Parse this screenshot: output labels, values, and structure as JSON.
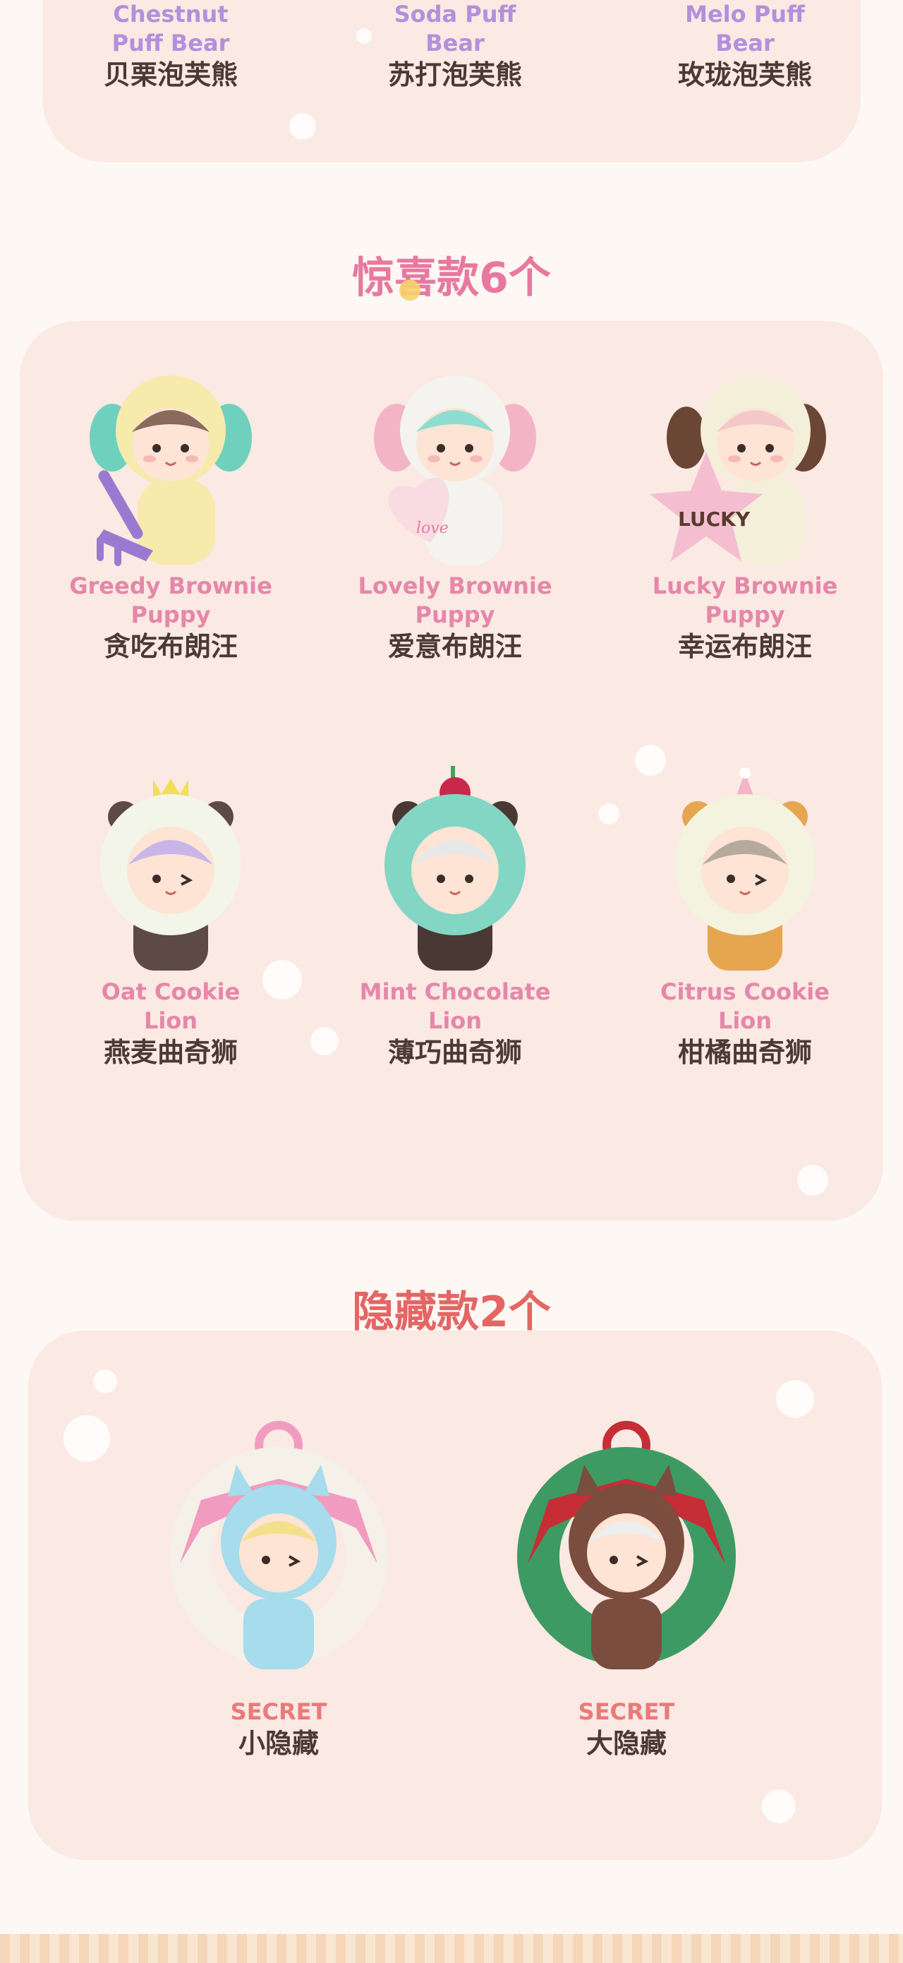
{
  "top_series": {
    "items": [
      {
        "en": "Chestnut Puff Bear",
        "cn": "贝栗泡芙熊"
      },
      {
        "en": "Soda Puff Bear",
        "cn": "苏打泡芙熊"
      },
      {
        "en": "Melo Puff Bear",
        "cn": "玫珑泡芙熊"
      }
    ]
  },
  "surprise": {
    "title": "惊喜款6个",
    "items": [
      {
        "en": "Greedy Brownie Puppy",
        "cn": "贪吃布朗汪",
        "icon": "puppy-figure-icon",
        "hood": "#f6ebab",
        "ear": "#6fd1bd",
        "prop": "rake"
      },
      {
        "en": "Lovely Brownie Puppy",
        "cn": "爱意布朗汪",
        "icon": "puppy-figure-icon",
        "hood": "#f4f3f0",
        "ear": "#f3b4c8",
        "prop": "heart",
        "prop_text": "love"
      },
      {
        "en": "Lucky Brownie Puppy",
        "cn": "幸运布朗汪",
        "icon": "puppy-figure-icon",
        "hood": "#f4efd9",
        "ear": "#6b4634",
        "prop": "star",
        "prop_text": "LUCKY"
      },
      {
        "en": "Oat Cookie Lion",
        "cn": "燕麦曲奇狮",
        "icon": "lion-figure-icon",
        "mane": "#f2f5e7",
        "hair": "#c9b6e8",
        "body": "#5e4a44",
        "topper": "crown"
      },
      {
        "en": "Mint Chocolate Lion",
        "cn": "薄巧曲奇狮",
        "icon": "lion-figure-icon",
        "mane": "#83d5c4",
        "hair": "#e8e8e8",
        "body": "#4a3835",
        "topper": "cherry"
      },
      {
        "en": "Citrus Cookie Lion",
        "cn": "柑橘曲奇狮",
        "icon": "lion-figure-icon",
        "mane": "#f4f3df",
        "hair": "#b6aa9c",
        "body": "#e6a54f",
        "topper": "party-hat"
      }
    ]
  },
  "secret": {
    "title": "隐藏款2个",
    "items": [
      {
        "en": "SECRET",
        "cn": "小隐藏",
        "icon": "wreath-figure-icon",
        "wreath": "#f5f0e8",
        "bow": "#f29bc1",
        "suit": "#a6dcec"
      },
      {
        "en": "SECRET",
        "cn": "大隐藏",
        "icon": "wreath-figure-icon",
        "wreath": "#3d9a63",
        "bow": "#c62d36",
        "suit": "#7a4d3e"
      }
    ]
  }
}
